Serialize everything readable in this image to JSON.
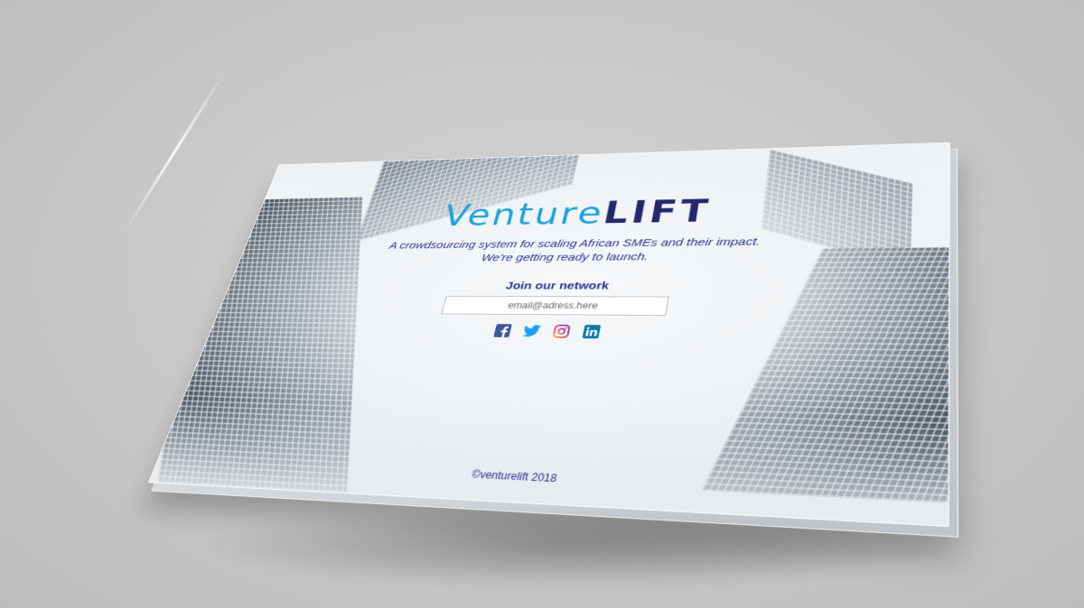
{
  "brand": {
    "logo_venture": "Venture",
    "logo_lift": "LIFT"
  },
  "hero": {
    "tagline_line1": "A crowdsourcing system for scaling African SMEs and their impact.",
    "tagline_line2": "We're getting ready to launch."
  },
  "signup": {
    "heading": "Join our network",
    "email_placeholder": "email@adress.here"
  },
  "social": [
    {
      "name": "facebook-icon",
      "color": "#3b5998"
    },
    {
      "name": "twitter-icon",
      "color": "#1da1f2"
    },
    {
      "name": "instagram-icon",
      "color": "#c13584"
    },
    {
      "name": "linkedin-icon",
      "color": "#0e76a8"
    }
  ],
  "footer": {
    "copyright": "©venturelift 2018"
  },
  "colors": {
    "brand_light_blue": "#1fa2de",
    "brand_navy": "#24286d",
    "text_blue": "#2b3390"
  }
}
